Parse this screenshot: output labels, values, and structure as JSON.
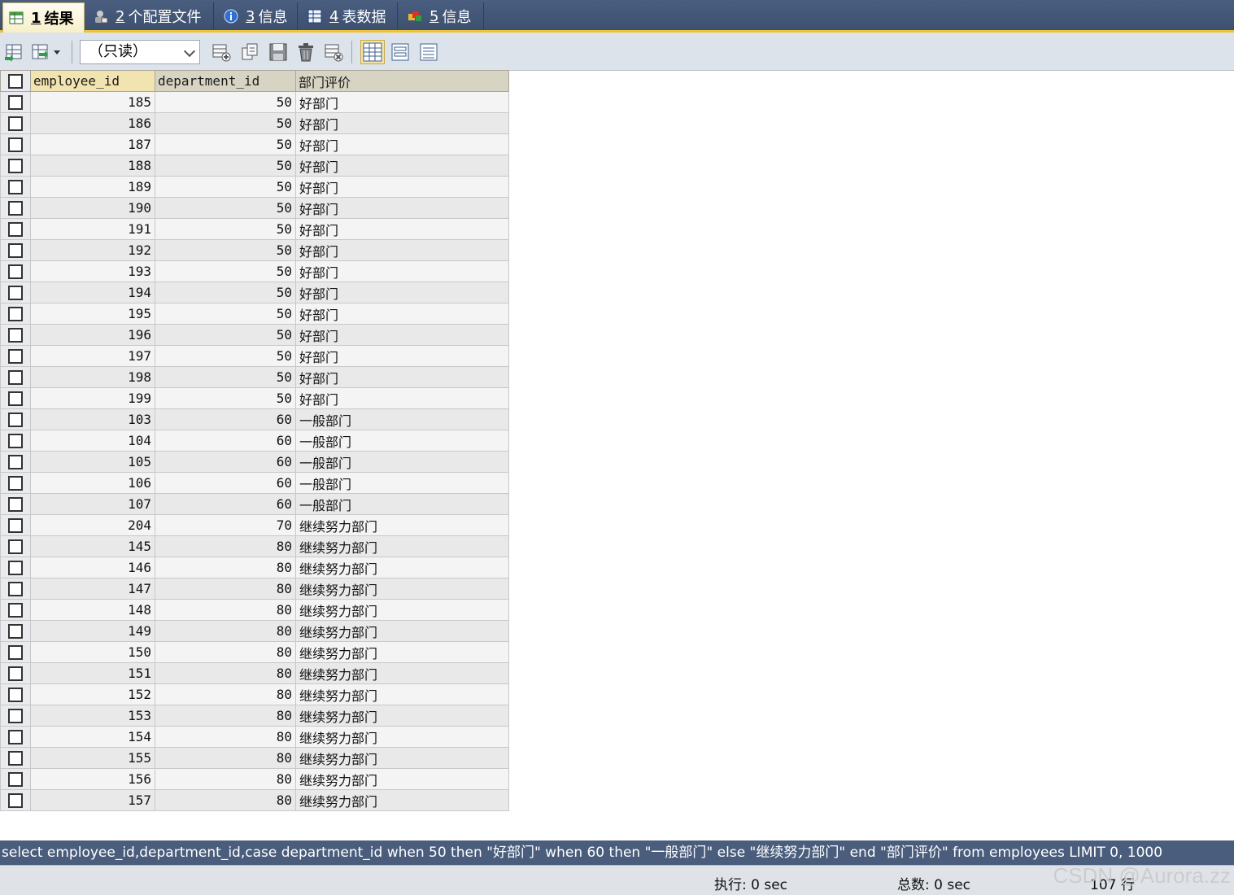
{
  "tabs": [
    {
      "num": "1",
      "label": "结果",
      "icon": "result-grid-icon",
      "active": true
    },
    {
      "num": "2",
      "label": "个配置文件",
      "icon": "profile-icon",
      "active": false
    },
    {
      "num": "3",
      "label": "信息",
      "icon": "info-icon",
      "active": false
    },
    {
      "num": "4",
      "label": "表数据",
      "icon": "table-data-icon",
      "active": false
    },
    {
      "num": "5",
      "label": "信息",
      "icon": "info-colorful-icon",
      "active": false
    }
  ],
  "toolbar": {
    "mode": "（只读）",
    "buttons": [
      "export-icon",
      "import-icon",
      "add-row-icon",
      "duplicate-row-icon",
      "save-icon",
      "delete-row-icon",
      "discard-icon",
      "grid-view-icon",
      "form-view-icon",
      "text-view-icon"
    ]
  },
  "grid": {
    "columns": [
      "employee_id",
      "department_id",
      "部门评价"
    ],
    "rows": [
      [
        "185",
        "50",
        "好部门"
      ],
      [
        "186",
        "50",
        "好部门"
      ],
      [
        "187",
        "50",
        "好部门"
      ],
      [
        "188",
        "50",
        "好部门"
      ],
      [
        "189",
        "50",
        "好部门"
      ],
      [
        "190",
        "50",
        "好部门"
      ],
      [
        "191",
        "50",
        "好部门"
      ],
      [
        "192",
        "50",
        "好部门"
      ],
      [
        "193",
        "50",
        "好部门"
      ],
      [
        "194",
        "50",
        "好部门"
      ],
      [
        "195",
        "50",
        "好部门"
      ],
      [
        "196",
        "50",
        "好部门"
      ],
      [
        "197",
        "50",
        "好部门"
      ],
      [
        "198",
        "50",
        "好部门"
      ],
      [
        "199",
        "50",
        "好部门"
      ],
      [
        "103",
        "60",
        "一般部门"
      ],
      [
        "104",
        "60",
        "一般部门"
      ],
      [
        "105",
        "60",
        "一般部门"
      ],
      [
        "106",
        "60",
        "一般部门"
      ],
      [
        "107",
        "60",
        "一般部门"
      ],
      [
        "204",
        "70",
        "继续努力部门"
      ],
      [
        "145",
        "80",
        "继续努力部门"
      ],
      [
        "146",
        "80",
        "继续努力部门"
      ],
      [
        "147",
        "80",
        "继续努力部门"
      ],
      [
        "148",
        "80",
        "继续努力部门"
      ],
      [
        "149",
        "80",
        "继续努力部门"
      ],
      [
        "150",
        "80",
        "继续努力部门"
      ],
      [
        "151",
        "80",
        "继续努力部门"
      ],
      [
        "152",
        "80",
        "继续努力部门"
      ],
      [
        "153",
        "80",
        "继续努力部门"
      ],
      [
        "154",
        "80",
        "继续努力部门"
      ],
      [
        "155",
        "80",
        "继续努力部门"
      ],
      [
        "156",
        "80",
        "继续努力部门"
      ],
      [
        "157",
        "80",
        "继续努力部门"
      ]
    ]
  },
  "sql": "select employee_id,department_id,case department_id when 50 then \"好部门\" when 60 then \"一般部门\" else \"继续努力部门\" end \"部门评价\" from employees LIMIT 0, 1000",
  "status": {
    "exec": "执行: 0 sec",
    "total": "总数: 0 sec",
    "rows": "107 行"
  },
  "watermark": "CSDN @Aurora.zz",
  "colors": {
    "tabbar": "#3d506f",
    "accent": "#f1c232",
    "sqlbar": "#4a5d7c"
  }
}
